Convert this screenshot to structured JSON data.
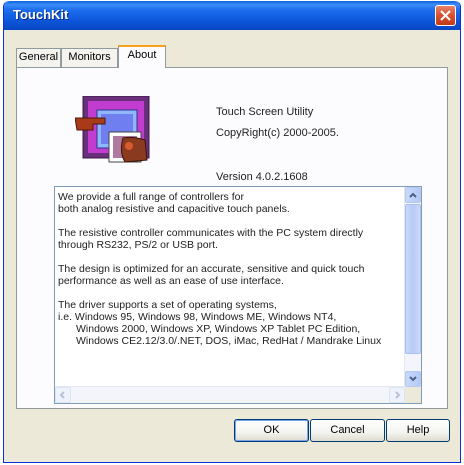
{
  "window": {
    "title": "TouchKit",
    "colors": {
      "titlebar": "#0b55d8",
      "close": "#d8502f",
      "face": "#ece9d8"
    }
  },
  "tabs": [
    {
      "label": "General",
      "active": false
    },
    {
      "label": "Monitors",
      "active": false
    },
    {
      "label": "About",
      "active": true
    }
  ],
  "about": {
    "logo_icon": "touchkit-app-icon",
    "product": "Touch Screen Utility",
    "copyright": "CopyRight(c) 2000-2005.",
    "version": "Version 4.0.2.1608",
    "description": {
      "p1_l1": "We provide a full range of controllers for",
      "p1_l2": "both analog resistive and capacitive touch panels.",
      "p2_l1": "The resistive controller communicates with the PC system directly",
      "p2_l2": "through RS232, PS/2 or USB port.",
      "p3_l1": "The design is optimized for an accurate, sensitive and quick touch",
      "p3_l2": "performance as well as an ease of use interface.",
      "p4_l1": "The driver supports a set of operating systems,",
      "p4_l2": "i.e. Windows 95, Windows 98, Windows ME, Windows NT4,",
      "p4_l3": "Windows 2000, Windows XP, Windows XP Tablet PC Edition,",
      "p4_l4": "Windows CE2.12/3.0/.NET, DOS, iMac, RedHat / Mandrake Linux"
    }
  },
  "buttons": {
    "ok": "OK",
    "cancel": "Cancel",
    "help": "Help"
  }
}
